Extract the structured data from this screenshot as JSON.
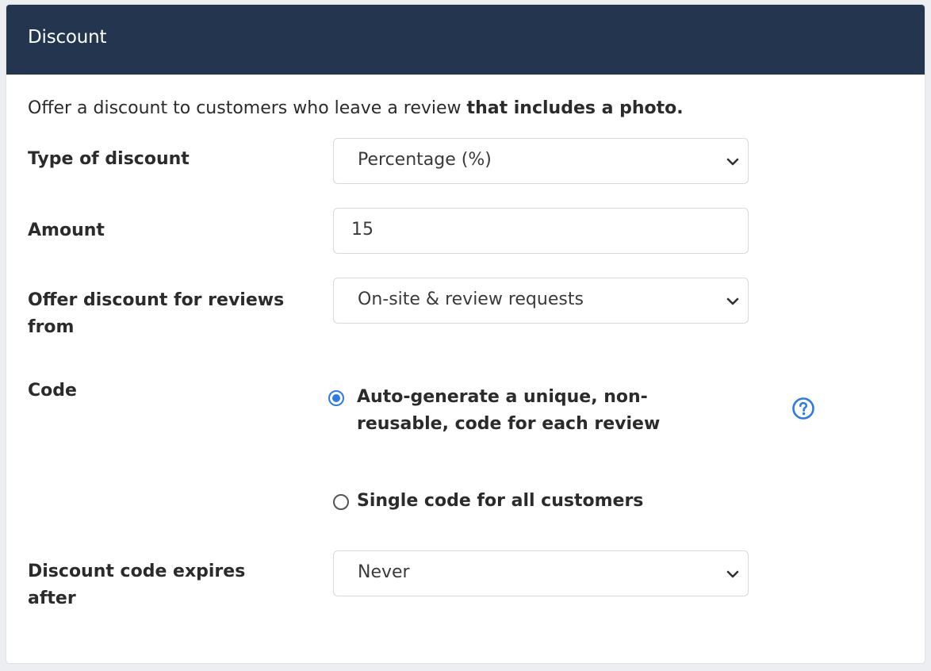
{
  "header": {
    "title": "Discount"
  },
  "intro": {
    "text": "Offer a discount to customers who leave a review ",
    "bold": "that includes a photo."
  },
  "type_of_discount": {
    "label": "Type of discount",
    "value": "Percentage (%)"
  },
  "amount": {
    "label": "Amount",
    "value": "15"
  },
  "reviews_from": {
    "label": "Offer discount for reviews from",
    "value": "On-site & review requests"
  },
  "code": {
    "label": "Code",
    "options": [
      {
        "label": "Auto-generate a unique, non-reusable, code for each review",
        "selected": true
      },
      {
        "label": "Single code for all customers",
        "selected": false
      }
    ],
    "help_icon": "question-circle-icon"
  },
  "expires": {
    "label": "Discount code expires after",
    "value": "Never"
  },
  "colors": {
    "header_bg": "#243550",
    "accent": "#2e7be6"
  }
}
